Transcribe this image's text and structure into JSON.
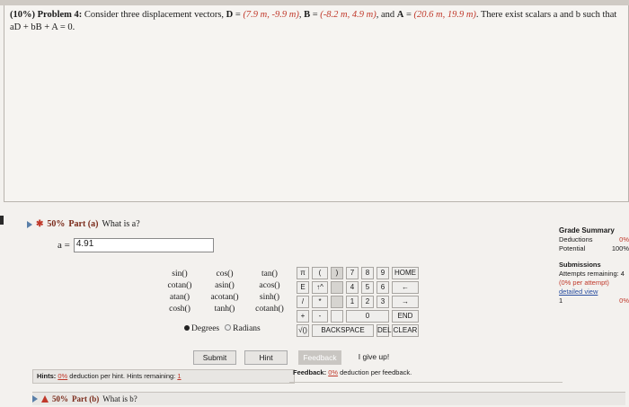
{
  "problem": {
    "weight": "(10%)",
    "title": "Problem 4:",
    "intro": "Consider three displacement vectors, ",
    "D_label": "D",
    "D_value": "(7.9 m, -9.9 m)",
    "B_label": "B",
    "B_value": "(-8.2 m, 4.9 m)",
    "A_label": "A",
    "A_value": "(20.6 m, 19.9 m)",
    "tail": ". There exist scalars a and b such that aD + bB + A = 0."
  },
  "part_a": {
    "percent": "50%",
    "label": "Part (a)",
    "question": "What is a?",
    "var_label": "a =",
    "input_value": "4.91"
  },
  "functions": [
    "sin()",
    "cos()",
    "tan()",
    "cotan()",
    "asin()",
    "acos()",
    "atan()",
    "acotan()",
    "sinh()",
    "cosh()",
    "tanh()",
    "cotanh()"
  ],
  "angle_mode": {
    "degrees": "Degrees",
    "radians": "Radians",
    "selected": "Degrees"
  },
  "keypad": {
    "row1": [
      "π",
      "(",
      ")",
      "7",
      "8",
      "9",
      "HOME"
    ],
    "row2": [
      "E",
      "↑^",
      "",
      "4",
      "5",
      "6",
      "←"
    ],
    "row3": [
      "/",
      "*",
      "",
      "1",
      "2",
      "3",
      "→"
    ],
    "row4": [
      "+",
      "-",
      "",
      "0",
      "",
      "",
      "END"
    ],
    "row5": [
      "√()",
      "BACKSPACE",
      "DEL",
      "CLEAR"
    ]
  },
  "buttons": {
    "submit": "Submit",
    "hint": "Hint",
    "feedback": "Feedback",
    "give_up": "I give up!"
  },
  "hints_bar": {
    "prefix": "Hints:",
    "pct": "0%",
    "text": "deduction per hint. Hints remaining:",
    "remaining": "1"
  },
  "feedback_bar": {
    "prefix": "Feedback:",
    "pct": "0%",
    "text": "deduction per feedback."
  },
  "part_b": {
    "percent": "50%",
    "label": "Part (b)",
    "question": "What is b?"
  },
  "grade_summary": {
    "title": "Grade Summary",
    "deductions_label": "Deductions",
    "deductions_value": "0%",
    "potential_label": "Potential",
    "potential_value": "100%",
    "submissions_title": "Submissions",
    "attempts_text": "Attempts remaining: 4",
    "per_attempt": "(0% per attempt)",
    "detailed_view": "detailed view",
    "row_index": "1",
    "row_value": "0%"
  }
}
